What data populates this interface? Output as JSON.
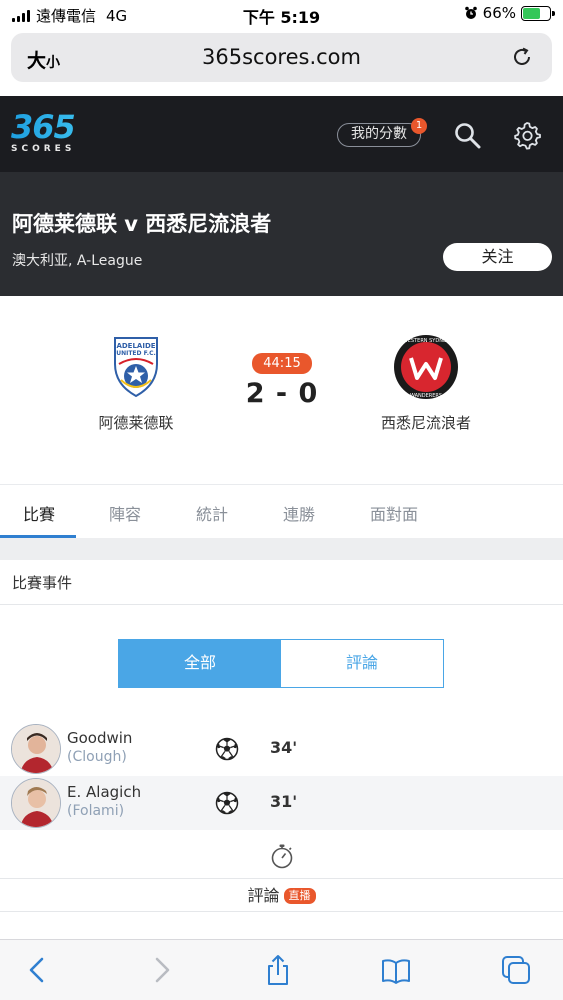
{
  "status_bar": {
    "carrier": "遠傳電信",
    "network": "4G",
    "time": "下午 5:19",
    "battery": "66%",
    "battery_level": 0.66
  },
  "browser": {
    "text_size_label": "大",
    "text_size_small": "小",
    "url": "365scores.com"
  },
  "site_header": {
    "logo_main": "365",
    "logo_sub": "SCORES",
    "my_scores_label": "我的分數",
    "notification_count": "1"
  },
  "match": {
    "title": "阿德莱德联 v 西悉尼流浪者",
    "competition": "澳大利亚, A-League",
    "follow_label": "关注",
    "home_team": "阿德莱德联",
    "away_team": "西悉尼流浪者",
    "clock": "44:15",
    "score": "2 - 0"
  },
  "tabs": [
    "比賽",
    "陣容",
    "統計",
    "連勝",
    "面對面"
  ],
  "events_section": {
    "title": "比賽事件",
    "filter_all": "全部",
    "filter_commentary": "評論"
  },
  "events": [
    {
      "player": "Goodwin",
      "assist": "(Clough)",
      "minute": "34'",
      "icon": "soccer-ball-icon"
    },
    {
      "player": "E. Alagich",
      "assist": "(Folami)",
      "minute": "31'",
      "icon": "soccer-ball-icon"
    }
  ],
  "commentary": {
    "label": "評論",
    "live_badge": "直播"
  },
  "colors": {
    "accent_blue": "#4aa6e6",
    "live_orange": "#e9572c",
    "header_dark": "#1b1c20",
    "band_dark": "#2b2d31"
  }
}
